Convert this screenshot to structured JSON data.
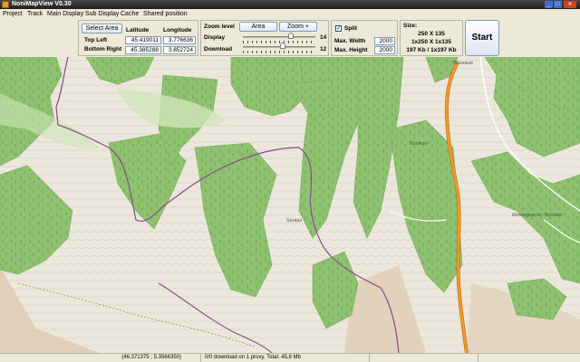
{
  "window": {
    "title": "NoniMapView V0.30"
  },
  "menu": [
    "Project",
    "Track",
    "Main Display",
    "Sub Display",
    "Cache",
    "Shared position"
  ],
  "area": {
    "select_button": "Select Area",
    "latitude_header": "Latitude",
    "longitude_header": "Longitude",
    "top_left_label": "Top Left",
    "bottom_right_label": "Bottom Right",
    "top_left_lat": "45.419011",
    "top_left_lon": "3.776636",
    "bottom_right_lat": "45.385288",
    "bottom_right_lon": "3.852724"
  },
  "zoom": {
    "label": "Zoom level",
    "area_button": "Area",
    "zoom_plus_button": "Zoom +",
    "display_label": "Display",
    "display_value": "14",
    "download_label": "Download",
    "download_value": "12"
  },
  "split": {
    "label": "Split",
    "checked": true,
    "max_width_label": "Max. Width",
    "max_width_value": "2000",
    "max_height_label": "Max. Height",
    "max_height_value": "2000"
  },
  "size": {
    "label": "Size:",
    "line1": "250 X 135",
    "line2": "1x250 X 1x135",
    "line3": "197 Kb / 1x197 Kb"
  },
  "start_button": "Start",
  "map": {
    "places": [
      "Bézeaud",
      "Brioisse",
      "Soutas",
      "Montagnac-le-Templier"
    ]
  },
  "status": {
    "coordinates": "(46.371375 ; 5.3566350)",
    "download": "0/0 download on 1 proxy, Total: 45,8 Mb"
  },
  "colors": {
    "forest": "#8ec270",
    "forest_dark": "#74ad5a",
    "meadow": "#ece7dc",
    "rock": "#e0cfb9",
    "road": "#ef9a2c",
    "boundary": "#8b4a8b"
  }
}
